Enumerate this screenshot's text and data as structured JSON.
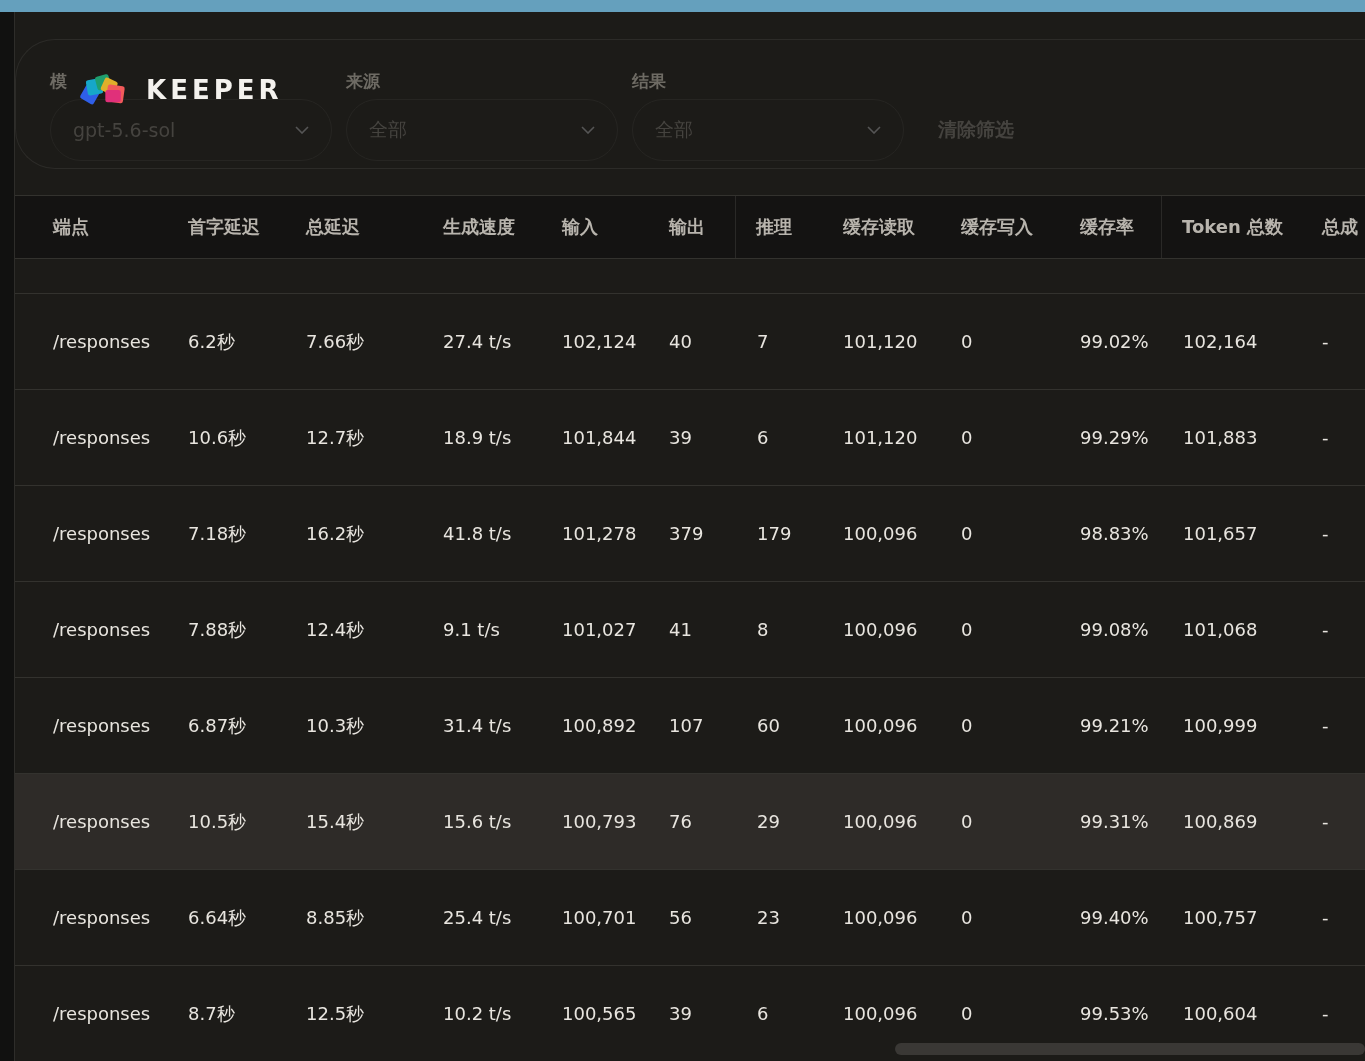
{
  "logo": {
    "text": "KEEPER"
  },
  "filters": [
    {
      "label": "模",
      "value": "gpt-5.6-sol"
    },
    {
      "label": "来源",
      "value": "全部"
    },
    {
      "label": "结果",
      "value": "全部"
    }
  ],
  "clear_filters": "清除筛选",
  "table": {
    "columns": [
      "端点",
      "首字延迟",
      "总延迟",
      "生成速度",
      "输入",
      "输出",
      "推理",
      "缓存读取",
      "缓存写入",
      "缓存率",
      "Token 总数",
      "总成"
    ],
    "rows": [
      {
        "highlighted": false,
        "cells": [
          "/responses",
          "6.2秒",
          "7.66秒",
          "27.4 t/s",
          "102,124",
          "40",
          "7",
          "101,120",
          "0",
          "99.02%",
          "102,164",
          "-"
        ]
      },
      {
        "highlighted": false,
        "cells": [
          "/responses",
          "10.6秒",
          "12.7秒",
          "18.9 t/s",
          "101,844",
          "39",
          "6",
          "101,120",
          "0",
          "99.29%",
          "101,883",
          "-"
        ]
      },
      {
        "highlighted": false,
        "cells": [
          "/responses",
          "7.18秒",
          "16.2秒",
          "41.8 t/s",
          "101,278",
          "379",
          "179",
          "100,096",
          "0",
          "98.83%",
          "101,657",
          "-"
        ]
      },
      {
        "highlighted": false,
        "cells": [
          "/responses",
          "7.88秒",
          "12.4秒",
          "9.1 t/s",
          "101,027",
          "41",
          "8",
          "100,096",
          "0",
          "99.08%",
          "101,068",
          "-"
        ]
      },
      {
        "highlighted": false,
        "cells": [
          "/responses",
          "6.87秒",
          "10.3秒",
          "31.4 t/s",
          "100,892",
          "107",
          "60",
          "100,096",
          "0",
          "99.21%",
          "100,999",
          "-"
        ]
      },
      {
        "highlighted": true,
        "cells": [
          "/responses",
          "10.5秒",
          "15.4秒",
          "15.6 t/s",
          "100,793",
          "76",
          "29",
          "100,096",
          "0",
          "99.31%",
          "100,869",
          "-"
        ]
      },
      {
        "highlighted": false,
        "cells": [
          "/responses",
          "6.64秒",
          "8.85秒",
          "25.4 t/s",
          "100,701",
          "56",
          "23",
          "100,096",
          "0",
          "99.40%",
          "100,757",
          "-"
        ]
      },
      {
        "highlighted": false,
        "cells": [
          "/responses",
          "8.7秒",
          "12.5秒",
          "10.2 t/s",
          "100,565",
          "39",
          "6",
          "100,096",
          "0",
          "99.53%",
          "100,604",
          "-"
        ]
      }
    ]
  }
}
